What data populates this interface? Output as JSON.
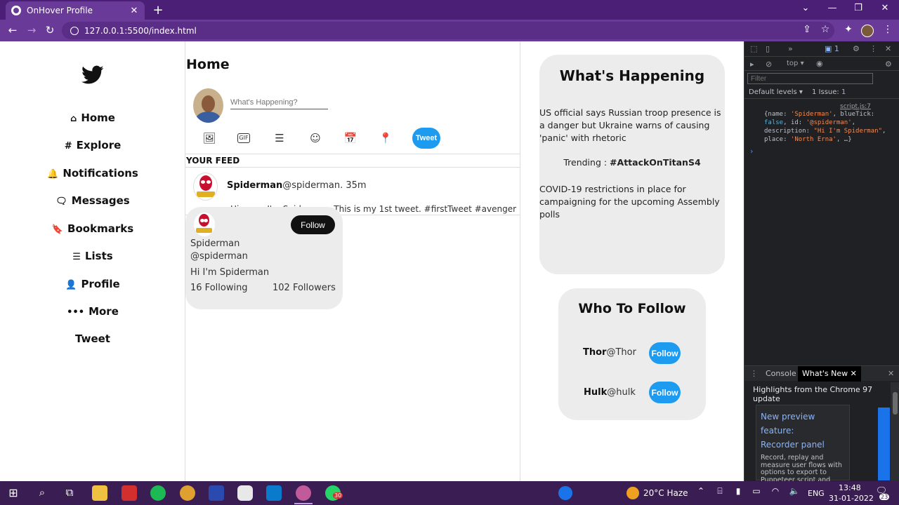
{
  "browser": {
    "tab_title": "OnHover Profile",
    "tab_close": "✕",
    "new_tab": "+",
    "url": "127.0.0.1:5500/index.html"
  },
  "sidebar": {
    "items": [
      {
        "label": "Home",
        "icon": "home-icon",
        "glyph": "⌂"
      },
      {
        "label": "Explore",
        "icon": "hash-icon",
        "glyph": "#"
      },
      {
        "label": "Notifications",
        "icon": "bell-icon",
        "glyph": "🔔"
      },
      {
        "label": "Messages",
        "icon": "messages-icon",
        "glyph": "🗨"
      },
      {
        "label": "Bookmarks",
        "icon": "bookmark-icon",
        "glyph": "🔖"
      },
      {
        "label": "Lists",
        "icon": "list-icon",
        "glyph": "☰"
      },
      {
        "label": "Profile",
        "icon": "person-icon",
        "glyph": "👤"
      },
      {
        "label": "More",
        "icon": "more-icon",
        "glyph": "•••"
      }
    ],
    "tweet_label": "Tweet"
  },
  "feed": {
    "title": "Home",
    "compose_placeholder": "What's Happening?",
    "tweet_button": "Tweet",
    "feed_label": "YOUR FEED",
    "post": {
      "name": "Spiderman",
      "handle_time": "@spiderman. 35m",
      "text": "Hi guys, I'm Spiderman. This is my 1st tweet. #firstTweet #avenger"
    },
    "hovercard": {
      "follow": "Follow",
      "name": "Spiderman",
      "handle": "@spiderman",
      "bio": "Hi I'm Spiderman",
      "following": "16 Following",
      "followers": "102 Followers"
    }
  },
  "happening": {
    "title": "What's Happening",
    "news1": "US official says Russian troop presence is a danger but Ukraine warns of causing 'panic' with rhetoric",
    "trend_label": "Trending : ",
    "trend_tag": "#AttackOnTitanS4",
    "news2": "COVID-19 restrictions in place for campaigning for the upcoming Assembly polls"
  },
  "who_to_follow": {
    "title": "Who To Follow",
    "users": [
      {
        "name": "Thor",
        "handle": "@Thor",
        "button": "Follow"
      },
      {
        "name": "Hulk",
        "handle": "@hulk",
        "button": "Follow"
      }
    ]
  },
  "devtools": {
    "issues_badge": "1",
    "context": "top ▾",
    "filter_placeholder": "Filter",
    "levels": "Default levels ▾",
    "issue_count": "1 Issue: ",
    "issue_num": "1",
    "script_link": "script.js:7",
    "drawer_console": "Console",
    "drawer_whatsnew": "What's New",
    "highlights": "Highlights from the Chrome 97 update",
    "card_title1": "New preview feature:",
    "card_title2": "Recorder panel",
    "card_desc": "Record, replay and measure user flows with options to export to Puppeteer script and more."
  },
  "taskbar": {
    "weather": "20°C  Haze",
    "lang": "ENG",
    "time": "13:48",
    "date": "31-01-2022",
    "notif_count": "23",
    "whatsapp_badge": "30"
  },
  "colors": {
    "accent": "#1d9bf0",
    "browser_frame": "#4b1f75",
    "card_bg": "#ececec"
  }
}
